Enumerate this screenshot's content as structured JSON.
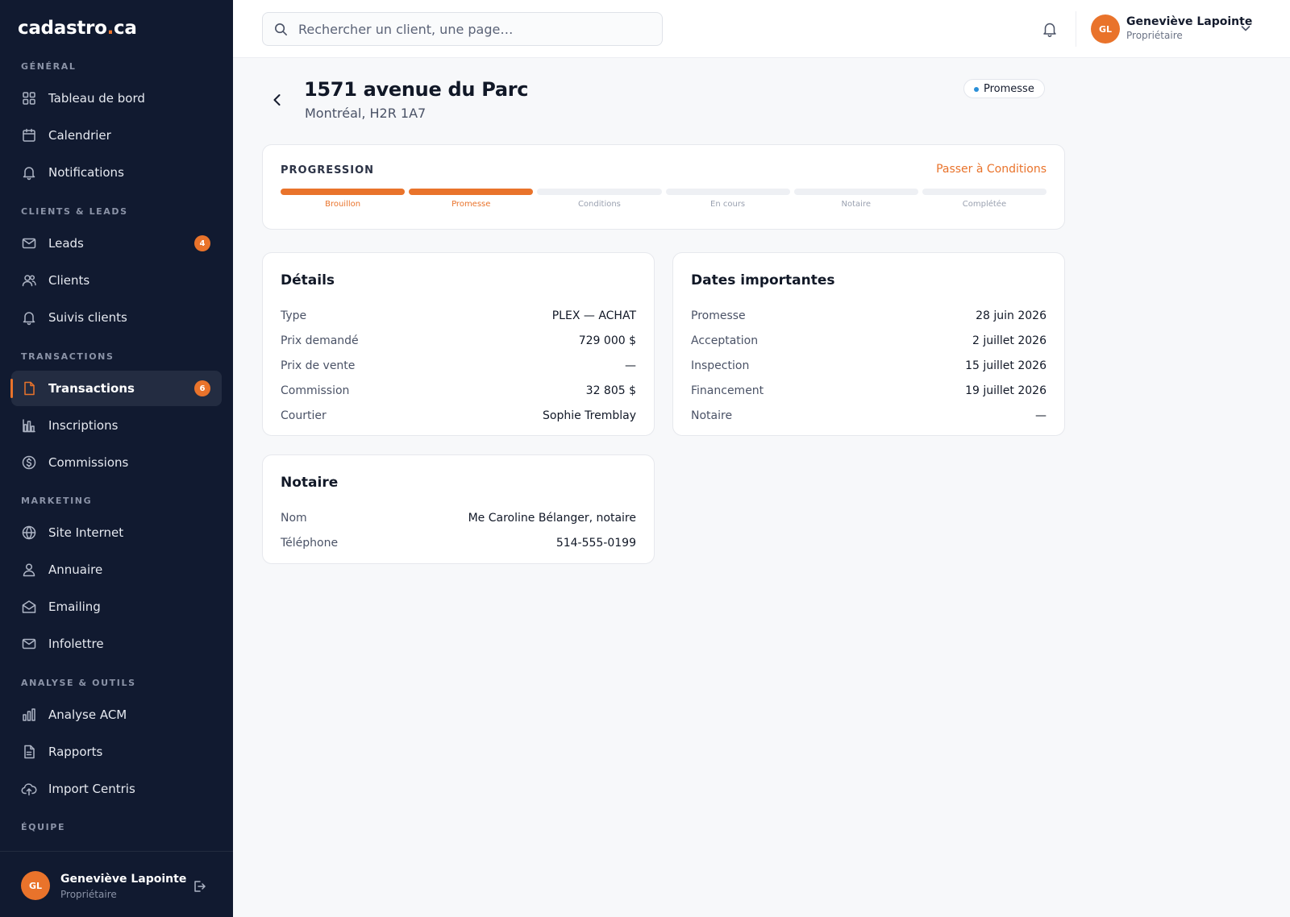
{
  "brand": {
    "name_main": "cadastro",
    "name_dot": ".",
    "name_tld": "ca"
  },
  "sidebar": {
    "sections": {
      "general": "GÉNÉRAL",
      "clients_leads": "CLIENTS & LEADS",
      "transactions": "TRANSACTIONS",
      "marketing": "MARKETING",
      "analyse": "ANALYSE & OUTILS",
      "equipe": "ÉQUIPE"
    },
    "items": [
      {
        "label": "Tableau de bord",
        "icon": "grid-icon"
      },
      {
        "label": "Calendrier",
        "icon": "calendar-icon"
      },
      {
        "label": "Notifications",
        "icon": "bell-icon"
      },
      {
        "label": "Leads",
        "icon": "mail-icon",
        "badge": "4"
      },
      {
        "label": "Clients",
        "icon": "users-icon"
      },
      {
        "label": "Suivis clients",
        "icon": "bell-icon"
      },
      {
        "label": "Transactions",
        "icon": "document-icon",
        "badge": "6",
        "active": true
      },
      {
        "label": "Inscriptions",
        "icon": "building-chart-icon"
      },
      {
        "label": "Commissions",
        "icon": "dollar-circle-icon"
      },
      {
        "label": "Site Internet",
        "icon": "globe-icon"
      },
      {
        "label": "Annuaire",
        "icon": "user-icon"
      },
      {
        "label": "Emailing",
        "icon": "mail-open-icon"
      },
      {
        "label": "Infolettre",
        "icon": "mail-icon"
      },
      {
        "label": "Analyse ACM",
        "icon": "bar-chart-icon"
      },
      {
        "label": "Rapports",
        "icon": "report-icon"
      },
      {
        "label": "Import Centris",
        "icon": "cloud-upload-icon"
      }
    ],
    "footer": {
      "initials": "GL",
      "name": "Geneviève Lapointe",
      "role": "Propriétaire"
    }
  },
  "header": {
    "search_placeholder": "Rechercher un client, une page…",
    "user": {
      "initials": "GL",
      "name": "Geneviève Lapointe",
      "role": "Propriétaire"
    }
  },
  "page": {
    "title": "1571 avenue du Parc",
    "subtitle": "Montréal, H2R 1A7",
    "status": "Promesse"
  },
  "progress": {
    "title": "PROGRESSION",
    "action": "Passer à Conditions",
    "completed_steps": 2,
    "steps": [
      "Brouillon",
      "Promesse",
      "Conditions",
      "En cours",
      "Notaire",
      "Complétée"
    ]
  },
  "details": {
    "title": "Détails",
    "rows": [
      {
        "k": "Type",
        "v": "PLEX — ACHAT"
      },
      {
        "k": "Prix demandé",
        "v": "729 000 $"
      },
      {
        "k": "Prix de vente",
        "v": "—"
      },
      {
        "k": "Commission",
        "v": "32 805 $"
      },
      {
        "k": "Courtier",
        "v": "Sophie Tremblay"
      }
    ]
  },
  "dates": {
    "title": "Dates importantes",
    "rows": [
      {
        "k": "Promesse",
        "v": "28 juin 2026"
      },
      {
        "k": "Acceptation",
        "v": "2 juillet 2026"
      },
      {
        "k": "Inspection",
        "v": "15 juillet 2026"
      },
      {
        "k": "Financement",
        "v": "19 juillet 2026"
      },
      {
        "k": "Notaire",
        "v": "—"
      }
    ]
  },
  "notaire": {
    "title": "Notaire",
    "rows": [
      {
        "k": "Nom",
        "v": "Me Caroline Bélanger, notaire"
      },
      {
        "k": "Téléphone",
        "v": "514-555-0199"
      }
    ]
  },
  "colors": {
    "accent": "#e9732b",
    "sidebar_bg": "#111a30",
    "status_dot": "#2a8fd8"
  }
}
